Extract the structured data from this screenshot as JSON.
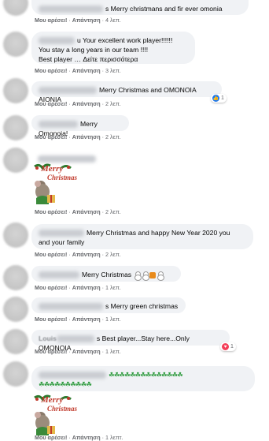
{
  "actions": {
    "like": "Μου αρέσει!",
    "reply": "Απάντηση",
    "dot": "·"
  },
  "comments": [
    {
      "text": "s Merry christmans and fir ever omonia",
      "time": "4 λεπ."
    },
    {
      "line1": "u Your excellent work player!!!!!!",
      "line2": "You stay a long years in our team !!!!",
      "line3": "Best player … Δείτε περισσότερα",
      "time": "3 λεπ."
    },
    {
      "text": "Merry Christmas and OMONOIA AIONIA",
      "time": "2 λεπ.",
      "reaction_count": "1",
      "reaction_icon": "like-icon"
    },
    {
      "text": "Merry Omonoia!",
      "time": "2 λεπ."
    },
    {
      "sticker_text_1": "Merry",
      "sticker_text_2": "Christmas",
      "time": "2 λεπ."
    },
    {
      "line1": "Merry Christmas and happy New Year 2020 you",
      "line2": "and your family",
      "time": "2 λεπ."
    },
    {
      "text": "Merry Christmas",
      "time": "1 λεπ."
    },
    {
      "text": "s Merry green christmas",
      "time": "1 λεπ."
    },
    {
      "name_fragment": "Louis",
      "text": "s Best player...Stay here...Only OMONOIA",
      "time": "1 λεπ.",
      "reaction_count": "1",
      "reaction_icon": "heart-icon"
    },
    {
      "clovers_1": "☘☘☘☘☘☘☘☘☘☘☘☘☘☘",
      "clovers_2": "☘☘☘☘☘☘☘☘☘☘",
      "sticker_text_1": "Merry",
      "sticker_text_2": "Christmas",
      "time": "1 λεπτ."
    }
  ],
  "colors": {
    "bubble": "#f0f2f5",
    "meta": "#65676b",
    "like": "#1877f2",
    "love": "#f33e58",
    "clover": "#2e9b3e"
  }
}
